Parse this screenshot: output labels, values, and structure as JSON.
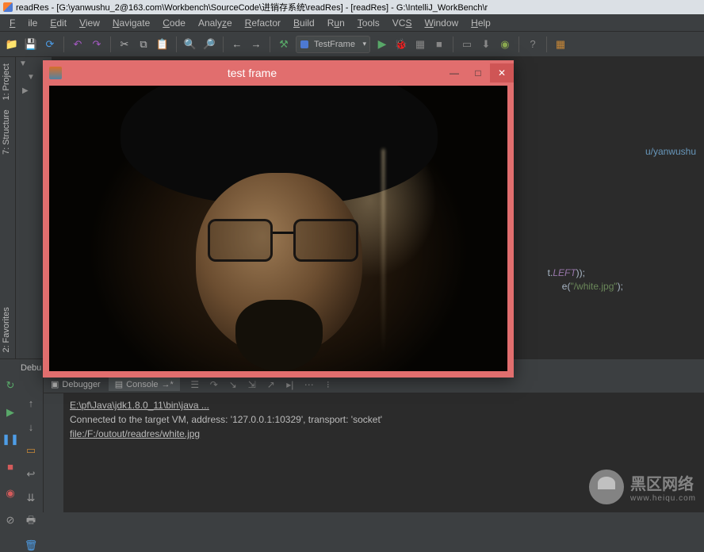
{
  "window": {
    "title": "readRes - [G:\\yanwushu_2@163.com\\Workbench\\SourceCode\\进销存系统\\readRes] - [readRes] - G:\\IntelliJ_WorkBench\\r"
  },
  "menu": {
    "file": "File",
    "edit": "Edit",
    "view": "View",
    "navigate": "Navigate",
    "code": "Code",
    "analyze": "Analyze",
    "refactor": "Refactor",
    "build": "Build",
    "run": "Run",
    "tools": "Tools",
    "vcs": "VCS",
    "window": "Window",
    "help": "Help"
  },
  "toolbar": {
    "runconfig": "TestFrame"
  },
  "side": {
    "project": "Project",
    "structure": "Structure",
    "favorites": "Favorites"
  },
  "editor": {
    "snippet_path": "u/yanwushu",
    "snippet1_a": "t.",
    "snippet1_b": "LEFT",
    "snippet1_c": "));",
    "snippet2_a": "e(",
    "snippet2_b": "\"/white.jpg\"",
    "snippet2_c": ");"
  },
  "bottom": {
    "debug_tab": "Debu",
    "debugger": "Debugger",
    "console": "Console",
    "out1": "E:\\pf\\Java\\jdk1.8.0_11\\bin\\java ...",
    "out2": "Connected to the target VM, address: '127.0.0.1:10329', transport: 'socket'",
    "out3": "file:/F:/outout/readres/white.jpg"
  },
  "popup": {
    "title": "test frame",
    "min": "—",
    "max": "□",
    "close": "✕"
  },
  "watermark": {
    "big": "黑区网络",
    "small": "www.heiqu.com"
  }
}
